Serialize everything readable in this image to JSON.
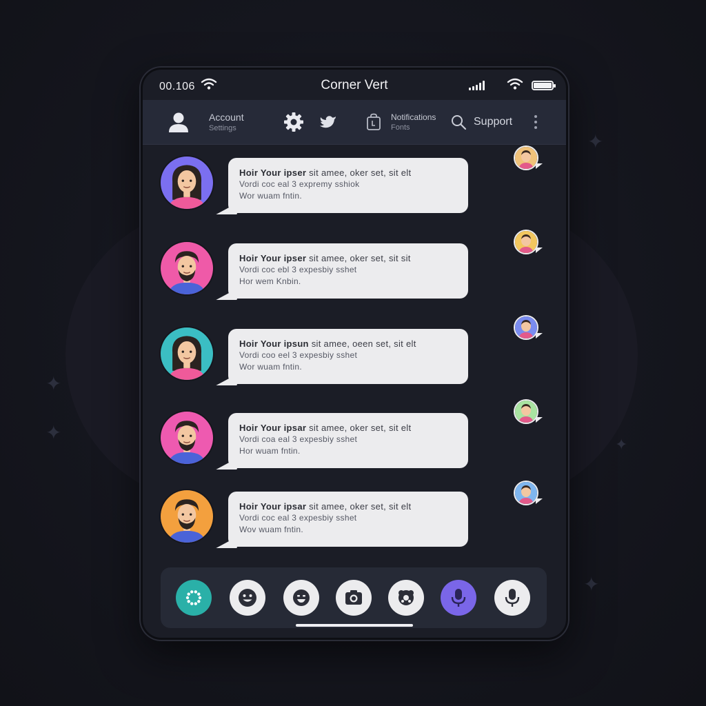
{
  "status_bar": {
    "time": "00.106",
    "title": "Corner Vert"
  },
  "toolbar": {
    "account_label": "Account",
    "account_sub": "Settings",
    "notifications_label": "Notifications",
    "notifications_sub": "Fonts",
    "support_label": "Support",
    "icons": [
      "user-icon",
      "gear-icon",
      "bird-icon",
      "bag-icon",
      "search-icon",
      "more-icon"
    ]
  },
  "messages": [
    {
      "line1_bold": "Hoir Your ipser",
      "line1_rest": " sit  amee,   oker  set,  sit  elt",
      "line2": "Vordi  coc  eal  3  expremy  sshiok",
      "line3": "Wor  wuam  fntin.",
      "avatar": "woman-long-hair",
      "avatar_bg": "#7b6ff0",
      "mini_bg": "#f0c27a"
    },
    {
      "line1_bold": "Hoir Your ipser",
      "line1_rest": " sit  amee,   oker  set,  sit  sit",
      "line2": "Vordi  coc  ebl  3  expesbiy  sshet",
      "line3": "Hor  wem  Knbin.",
      "avatar": "man-beard",
      "avatar_bg": "#ef5aa8",
      "mini_bg": "#f2c75f"
    },
    {
      "line1_bold": "Hoir Your ipsun",
      "line1_rest": " sit  amee,   oeen  set,  sit  elt",
      "line2": "Vordi  coo  eel  3  expesbiy  sshet",
      "line3": "Wor  wuam  fntin.",
      "avatar": "woman-long-hair",
      "avatar_bg": "#3bbec3",
      "mini_bg": "#7a8cf0"
    },
    {
      "line1_bold": "Hoir Your ipsar",
      "line1_rest": " sit  amee,   oker  set,  sit  elt",
      "line2": "Vordi  coa  eal  3  expesbiy  sshet",
      "line3": "Hor  wuam  fntin.",
      "avatar": "man-beard",
      "avatar_bg": "#ee5ab0",
      "mini_bg": "#a9e4a1"
    },
    {
      "line1_bold": "Hoir Your ipsar",
      "line1_rest": " sit  amee,   oker  set,  sit  elt",
      "line2": "Vordi  coc  eal  3  expesbiy  sshet",
      "line3": "Wov  wuam  fntin.",
      "avatar": "man-beard",
      "avatar_bg": "#f3a03e",
      "mini_bg": "#7fb6ef"
    }
  ],
  "action_bar": {
    "buttons": [
      "apps-icon",
      "smile-icon",
      "emoji-icon",
      "camera-icon",
      "sticker-icon",
      "mic-active-icon",
      "mic-icon"
    ],
    "active_color": "#7a66e8",
    "apps_color": "#2ab0a8"
  }
}
